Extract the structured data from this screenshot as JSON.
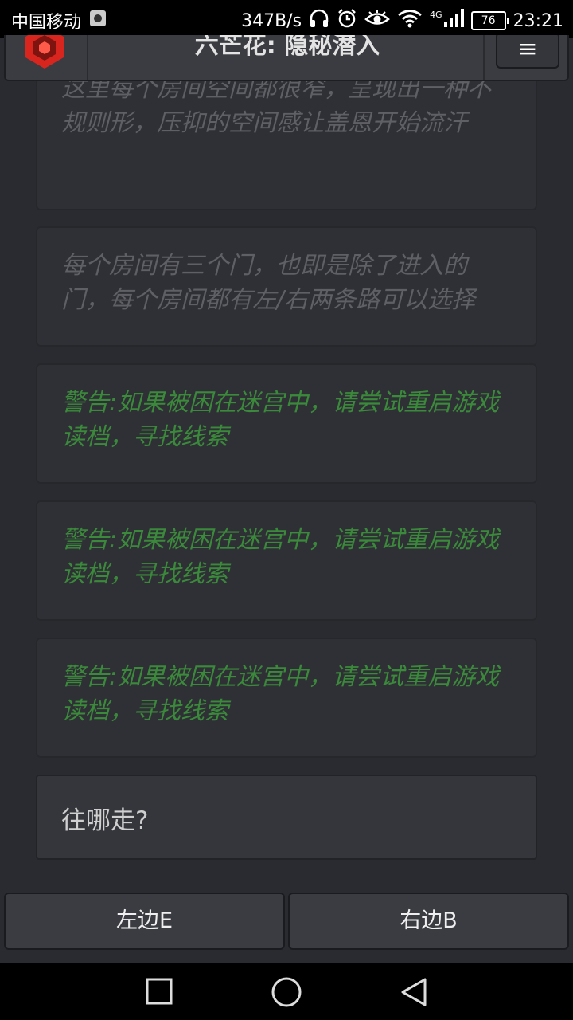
{
  "status_bar": {
    "carrier": "中国移动",
    "net_speed": "347B/s",
    "network_type": "4G",
    "battery": "76",
    "time": "23:21",
    "icons": [
      "notification-icon",
      "headphones-icon",
      "alarm-icon",
      "eye-icon",
      "wifi-icon",
      "signal-icon",
      "battery-icon"
    ]
  },
  "header": {
    "title": "六芒花: 隐秘潜入",
    "menu_symbol": "≡"
  },
  "cards": [
    {
      "style": "gray",
      "text": "这里每个房间空间都很窄，呈现出一种不规则形，压抑的空间感让盖恩开始流汗"
    },
    {
      "style": "gray",
      "text": "每个房间有三个门，也即是除了进入的门，每个房间都有左/右两条路可以选择"
    },
    {
      "style": "green",
      "text": "警告:如果被困在迷宫中，请尝试重启游戏读档，寻找线索"
    },
    {
      "style": "green",
      "text": "警告:如果被困在迷宫中，请尝试重启游戏读档，寻找线索"
    },
    {
      "style": "green",
      "text": "警告:如果被困在迷宫中，请尝试重启游戏读档，寻找线索"
    }
  ],
  "prompt": "往哪走?",
  "choices": {
    "left": "左边E",
    "right": "右边B"
  },
  "nav": {
    "icons": [
      "recent-apps-icon",
      "home-icon",
      "back-icon"
    ]
  },
  "colors": {
    "background": "#2a2b30",
    "card": "#2f3035",
    "warning_text": "#3b8a3b",
    "narration_text": "#5f6065",
    "logo_red": "#d8261e"
  }
}
